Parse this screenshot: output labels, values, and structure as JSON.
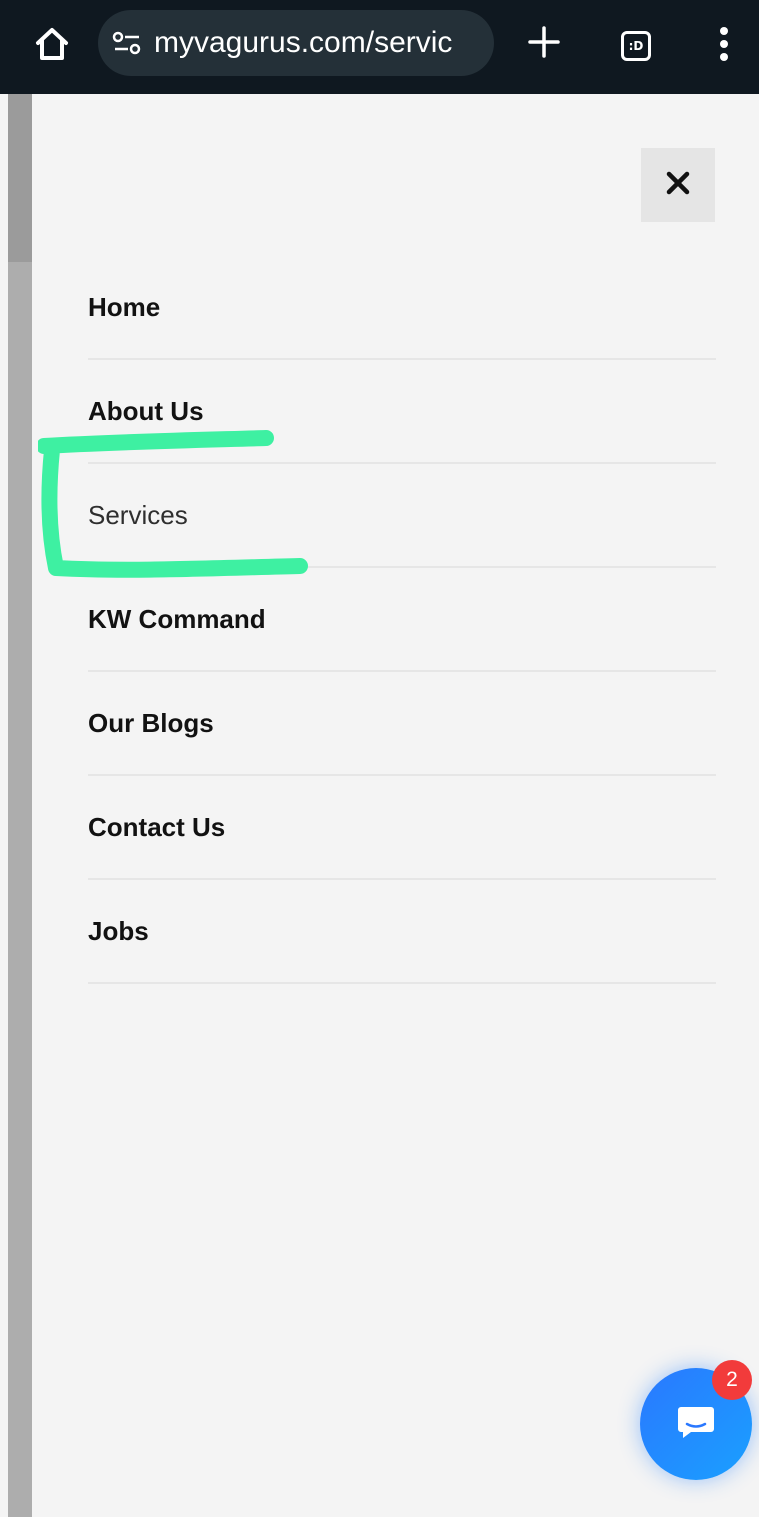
{
  "browser": {
    "url": "myvagurus.com/servic",
    "tab_switcher_label": ":D",
    "icons": {
      "home": "home-icon",
      "site_settings": "tune-icon",
      "new_tab": "plus-icon",
      "tab_switcher": "tab-switcher-icon",
      "menu": "more-vertical-icon"
    }
  },
  "menu": {
    "close_icon": "close-icon",
    "items": [
      {
        "label": "Home"
      },
      {
        "label": "About Us"
      },
      {
        "label": "Services"
      },
      {
        "label": "KW Command"
      },
      {
        "label": "Our Blogs"
      },
      {
        "label": "Contact Us"
      },
      {
        "label": "Jobs"
      }
    ],
    "active_item": "Services"
  },
  "chat_widget": {
    "icon": "chat-icon",
    "unread_count": "2",
    "colors": {
      "button": "#2a78ff",
      "badge": "#f23b3b"
    }
  },
  "annotation": {
    "color": "#3ef0a2",
    "marks": "Services"
  },
  "colors": {
    "topbar": "#0f1820",
    "background": "#f4f4f4"
  }
}
